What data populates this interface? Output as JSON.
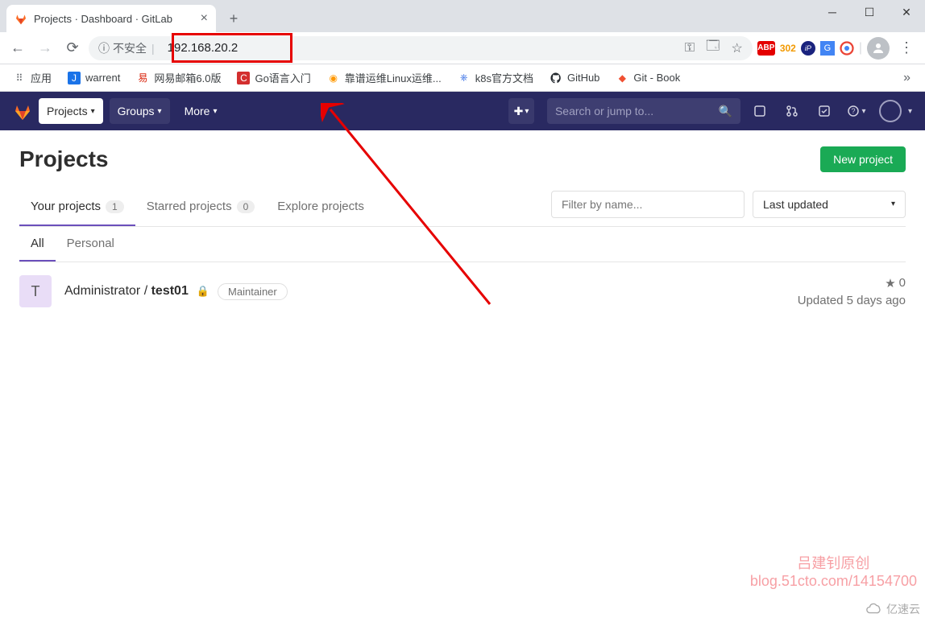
{
  "browser": {
    "tab_title": "Projects · Dashboard · GitLab",
    "url": "192.168.20.2",
    "security_label": "不安全",
    "ext_count": "302",
    "bookmarks": [
      {
        "icon": "apps",
        "label": "应用",
        "color": "#5f6368"
      },
      {
        "icon": "J",
        "label": "warrent",
        "color": "#1a73e8"
      },
      {
        "icon": "易",
        "label": "网易邮箱6.0版",
        "color": "#d81e06"
      },
      {
        "icon": "C",
        "label": "Go语言入门",
        "color": "#d32f2f"
      },
      {
        "icon": "◐",
        "label": "靠谱运维Linux运维...",
        "color": "#ff9800"
      },
      {
        "icon": "⎈",
        "label": "k8s官方文档",
        "color": "#326ce5"
      },
      {
        "icon": "gh",
        "label": "GitHub",
        "color": "#24292e"
      },
      {
        "icon": "◆",
        "label": "Git - Book",
        "color": "#f05032"
      }
    ]
  },
  "gitlab_header": {
    "projects_label": "Projects",
    "groups_label": "Groups",
    "more_label": "More",
    "search_placeholder": "Search or jump to..."
  },
  "page": {
    "title": "Projects",
    "new_project_btn": "New project",
    "tabs": [
      {
        "label": "Your projects",
        "count": "1",
        "active": true
      },
      {
        "label": "Starred projects",
        "count": "0",
        "active": false
      },
      {
        "label": "Explore projects",
        "count": null,
        "active": false
      }
    ],
    "filter_placeholder": "Filter by name...",
    "sort_label": "Last updated",
    "subtabs": [
      {
        "label": "All",
        "active": true
      },
      {
        "label": "Personal",
        "active": false
      }
    ],
    "project": {
      "avatar_letter": "T",
      "namespace": "Administrator / ",
      "name": "test01",
      "role": "Maintainer",
      "stars": "0",
      "updated": "Updated 5 days ago"
    }
  },
  "watermark": {
    "line1": "吕建钊原创",
    "line2": "blog.51cto.com/14154700",
    "corner": "亿速云"
  }
}
